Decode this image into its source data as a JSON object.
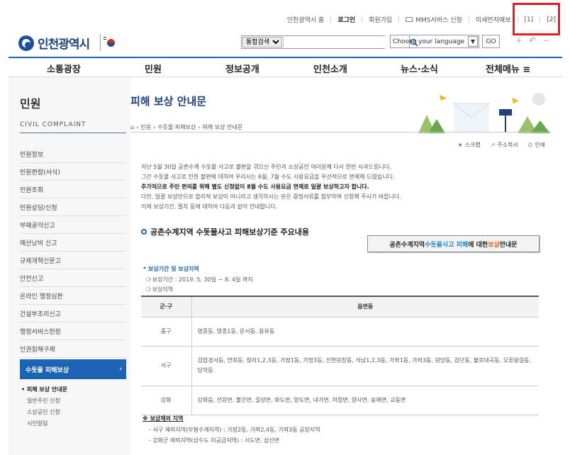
{
  "util": {
    "home": "인천광역시 홈",
    "login": "로그인",
    "join": "회원가입",
    "mms": "MMS서비스 신청",
    "dust": "미세먼지예보",
    "mark1": "[1]",
    "mark2": "[2]"
  },
  "header": {
    "logo": "인천광역시",
    "search_select": "통합검색",
    "lang_placeholder": "Choose your language",
    "go": "GO",
    "zoom_in": "+",
    "zoom_reset": "↶",
    "zoom_out": "−"
  },
  "gnb": [
    "소통광장",
    "민원",
    "정보공개",
    "인천소개",
    "뉴스·소식",
    "전체메뉴 ≡"
  ],
  "sidebar": {
    "title": "민원",
    "subtitle": "CIVIL COMPLAINT",
    "items": [
      "민원정보",
      "민원편람(서식)",
      "민원조회",
      "민원상담/신청",
      "부패공익신고",
      "예산낭비 신고",
      "규제개혁신문고",
      "안전신고",
      "온라인 행정심판",
      "건설부조리신고",
      "행정서비스헌장",
      "인권침해구제"
    ],
    "active": "수돗물 피해보상",
    "sub_items": [
      "• 피해 보상 안내문",
      "일반주민 신청",
      "소상공인 신청",
      "시민알림"
    ]
  },
  "main": {
    "title": "피해 보상 안내문",
    "breadcrumb": [
      "민원",
      "수돗물 피해보상",
      "피해 보상 안내문"
    ],
    "tools": [
      "스크랩",
      "주소복사",
      "인쇄"
    ],
    "intro": [
      "지난 5월 30일 공촌수계 수돗물 사고로 불편을 겪으신 주민과 소상공인 여러분께 다시 한번 사과드립니다.",
      "그간 수돗물 사고로 인한 불편에 대하여 우리시는 6월, 7월 수도 사용요금을 우선적으로 면제해 드렸습니다.",
      "추가적으로 주민 편의를 위해 별도 신청없이 8월 수도 사용요금 면제로 일괄 보상하고자 합니다.",
      "다만, 일괄 보상만으로 합리적 보상이 아니라고 생각하시는 분은 증빙서류를 첨부하여 신청해 주시기 바랍니다.",
      "이에 보상기간, 절차 등에 대하여 다음과 같이 안내합니다."
    ],
    "section_title": "공촌수계지역 수돗물사고 피해보상기준 주요내용",
    "guide_btn": {
      "p1": "공촌수계지역 ",
      "p2": "수돗물사고 피해",
      "p3": "에 대한 ",
      "p4": "보상",
      "p5": " 안내문"
    },
    "sub_heading": "* 보상기간 및 보상지역",
    "period": "❍ 보상기간 : 2019. 5. 30일 ~ 8. 4일 까지",
    "region": "❍ 보상지역",
    "table": {
      "headers": [
        "군·구",
        "읍면동"
      ],
      "rows": [
        {
          "gu": "중구",
          "dong": "영종동, 영종1동, 운서동, 용유동"
        },
        {
          "gu": "서구",
          "dong": "검암경서동, 연희동, 청라1,2,3동, 가정1동, 가정3동, 신현원창동, 석남1,2,3동, 가좌1동, 가좌3동, 원당동, 검단동, 불로대곡동, 오류왕길동,당하동"
        },
        {
          "gu": "강화",
          "dong": "강화읍, 선원면, 불은면, 길상면, 화도면, 양도면, 내가면, 하점면, 양사면, 송해면, 교동면"
        }
      ]
    },
    "except_title": "※ 보상제외 지역",
    "except": [
      "- 서구 제외지역(부평수계지역) : 가정2동, 가좌2,4동, 가좌3동 공장지역",
      "- 강화군 제외지역(상수도 미공급지역) : 서도면, 삼산면"
    ]
  }
}
